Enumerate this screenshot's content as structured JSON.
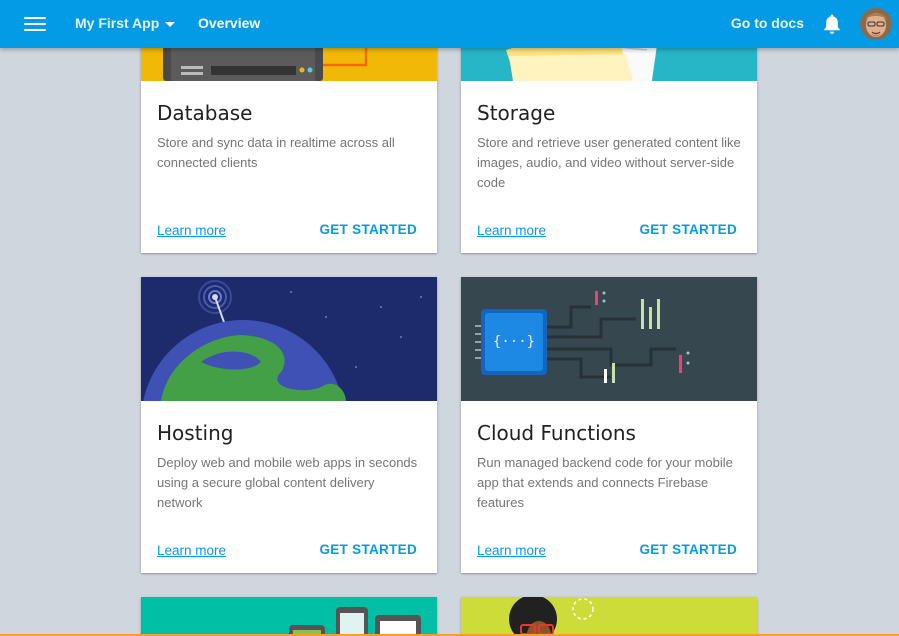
{
  "header": {
    "app_name": "My First App",
    "page_title": "Overview",
    "docs_link": "Go to docs",
    "accent": "#039be5"
  },
  "icons": [
    "menu-icon",
    "chevron-down-icon",
    "bell-icon",
    "avatar"
  ],
  "cards": [
    {
      "title": "Database",
      "description": "Store and sync data in realtime across all connected clients",
      "learn_more": "Learn more",
      "cta": "GET STARTED",
      "art_color": "#f2b807"
    },
    {
      "title": "Storage",
      "description": "Store and retrieve user generated content like images, audio, and video without server-side code",
      "learn_more": "Learn more",
      "cta": "GET STARTED",
      "art_color": "#26b6c8"
    },
    {
      "title": "Hosting",
      "description": "Deploy web and mobile web apps in seconds using a secure global content delivery network",
      "learn_more": "Learn more",
      "cta": "GET STARTED",
      "art_color": "#1d2a6b"
    },
    {
      "title": "Cloud Functions",
      "description": "Run managed backend code for your mobile app that extends and connects Firebase features",
      "learn_more": "Learn more",
      "cta": "GET STARTED",
      "art_color": "#37474f"
    }
  ],
  "partial_cards": [
    {
      "art_color": "#00bfa5"
    },
    {
      "art_color": "#cddc39"
    }
  ]
}
